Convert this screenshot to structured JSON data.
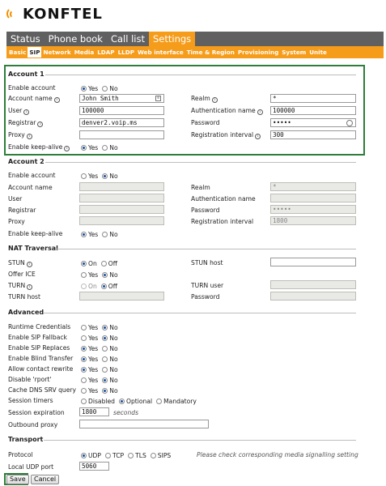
{
  "logo": {
    "text": "KONFTEL"
  },
  "topnav": [
    {
      "label": "Status",
      "active": false
    },
    {
      "label": "Phone book",
      "active": false
    },
    {
      "label": "Call list",
      "active": false
    },
    {
      "label": "Settings",
      "active": true
    }
  ],
  "subnav": [
    {
      "label": "Basic",
      "active": false
    },
    {
      "label": "SIP",
      "active": true
    },
    {
      "label": "Network",
      "active": false
    },
    {
      "label": "Media",
      "active": false
    },
    {
      "label": "LDAP",
      "active": false
    },
    {
      "label": "LLDP",
      "active": false
    },
    {
      "label": "Web interface",
      "active": false
    },
    {
      "label": "Time & Region",
      "active": false
    },
    {
      "label": "Provisioning",
      "active": false
    },
    {
      "label": "System",
      "active": false
    },
    {
      "label": "Unite",
      "active": false
    }
  ],
  "account1": {
    "title": "Account 1",
    "enable_account": {
      "label": "Enable account",
      "yes": "Yes",
      "no": "No",
      "value": "Yes"
    },
    "account_name": {
      "label": "Account name",
      "value": "John Smith"
    },
    "realm": {
      "label": "Realm",
      "value": "*"
    },
    "user": {
      "label": "User",
      "value": "100000"
    },
    "auth_name": {
      "label": "Authentication name",
      "value": "100000"
    },
    "registrar": {
      "label": "Registrar",
      "value": "denver2.voip.ms"
    },
    "password": {
      "label": "Password",
      "value": "•••••"
    },
    "proxy": {
      "label": "Proxy",
      "value": ""
    },
    "reg_interval": {
      "label": "Registration interval",
      "value": "300"
    },
    "keep_alive": {
      "label": "Enable keep-alive",
      "yes": "Yes",
      "no": "No",
      "value": "Yes"
    }
  },
  "account2": {
    "title": "Account 2",
    "enable_account": {
      "label": "Enable account",
      "yes": "Yes",
      "no": "No",
      "value": "No"
    },
    "account_name": {
      "label": "Account name",
      "value": ""
    },
    "realm": {
      "label": "Realm",
      "value": "*"
    },
    "user": {
      "label": "User",
      "value": ""
    },
    "auth_name": {
      "label": "Authentication name",
      "value": ""
    },
    "registrar": {
      "label": "Registrar",
      "value": ""
    },
    "password": {
      "label": "Password",
      "value": "•••••"
    },
    "proxy": {
      "label": "Proxy",
      "value": ""
    },
    "reg_interval": {
      "label": "Registration interval",
      "value": "1800"
    },
    "keep_alive": {
      "label": "Enable keep-alive",
      "yes": "Yes",
      "no": "No",
      "value": "Yes"
    }
  },
  "nat": {
    "title": "NAT Traversal",
    "stun": {
      "label": "STUN",
      "on": "On",
      "off": "Off",
      "value": "On"
    },
    "stun_host": {
      "label": "STUN host",
      "value": ""
    },
    "offer_ice": {
      "label": "Offer ICE",
      "yes": "Yes",
      "no": "No",
      "value": "No"
    },
    "turn": {
      "label": "TURN",
      "on": "On",
      "off": "Off",
      "value": "Off"
    },
    "turn_user": {
      "label": "TURN user",
      "value": ""
    },
    "turn_host": {
      "label": "TURN host",
      "value": ""
    },
    "turn_password": {
      "label": "Password",
      "value": ""
    }
  },
  "advanced": {
    "title": "Advanced",
    "rows": [
      {
        "label": "Runtime Credentials",
        "yes": "Yes",
        "no": "No",
        "value": "No"
      },
      {
        "label": "Enable SIP Fallback",
        "yes": "Yes",
        "no": "No",
        "value": "No"
      },
      {
        "label": "Enable SIP Replaces",
        "yes": "Yes",
        "no": "No",
        "value": "Yes"
      },
      {
        "label": "Enable Blind Transfer",
        "yes": "Yes",
        "no": "No",
        "value": "Yes"
      },
      {
        "label": "Allow contact rewrite",
        "yes": "Yes",
        "no": "No",
        "value": "Yes"
      },
      {
        "label": "Disable 'rport'",
        "yes": "Yes",
        "no": "No",
        "value": "No"
      },
      {
        "label": "Cache DNS SRV query",
        "yes": "Yes",
        "no": "No",
        "value": "No"
      }
    ],
    "session_timers": {
      "label": "Session timers",
      "options": [
        "Disabled",
        "Optional",
        "Mandatory"
      ],
      "value": "Optional"
    },
    "session_expiration": {
      "label": "Session expiration",
      "value": "1800",
      "unit": "seconds"
    },
    "outbound_proxy": {
      "label": "Outbound proxy",
      "value": ""
    }
  },
  "transport": {
    "title": "Transport",
    "protocol": {
      "label": "Protocol",
      "options": [
        "UDP",
        "TCP",
        "TLS",
        "SIPS"
      ],
      "value": "UDP"
    },
    "note": "Please check corresponding media signalling setting",
    "local_port": {
      "label": "Local UDP port",
      "value": "5060"
    }
  },
  "buttons": {
    "save": "Save",
    "cancel": "Cancel"
  },
  "colors": {
    "accent": "#f59c1a",
    "nav": "#606060",
    "highlight": "#2e7d3a"
  }
}
